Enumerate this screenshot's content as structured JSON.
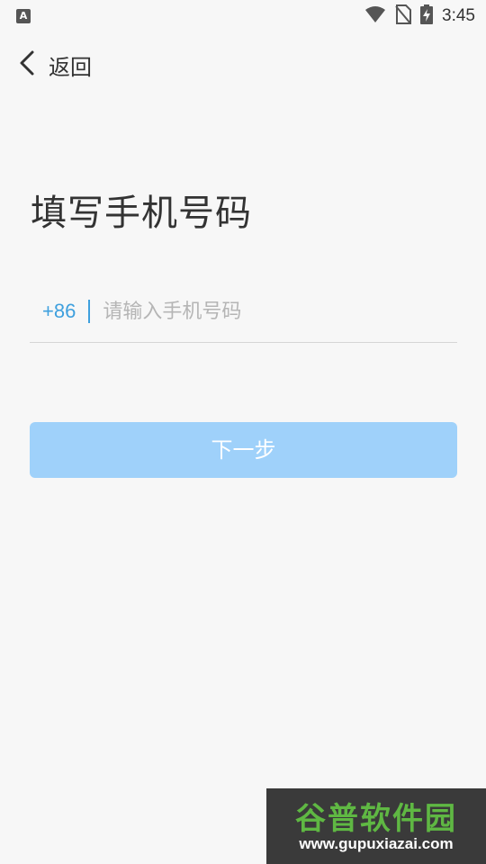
{
  "status_bar": {
    "left_badge": "A",
    "time": "3:45",
    "icons": [
      "notification-a-icon",
      "wifi-icon",
      "no-sim-icon",
      "battery-charging-icon"
    ]
  },
  "nav": {
    "back_label": "返回",
    "back_icon": "chevron-left-icon"
  },
  "page": {
    "title": "填写手机号码"
  },
  "phone_form": {
    "country_code": "+86",
    "input_value": "",
    "input_placeholder": "请输入手机号码"
  },
  "actions": {
    "next_label": "下一步",
    "next_enabled": false
  },
  "watermark": {
    "title": "谷普软件园",
    "url": "www.gupuxiazai.com"
  },
  "colors": {
    "background": "#f7f7f7",
    "accent": "#3fa0de",
    "button_disabled": "#9fd1fa",
    "text": "#333333",
    "placeholder": "#b5b5b5"
  }
}
